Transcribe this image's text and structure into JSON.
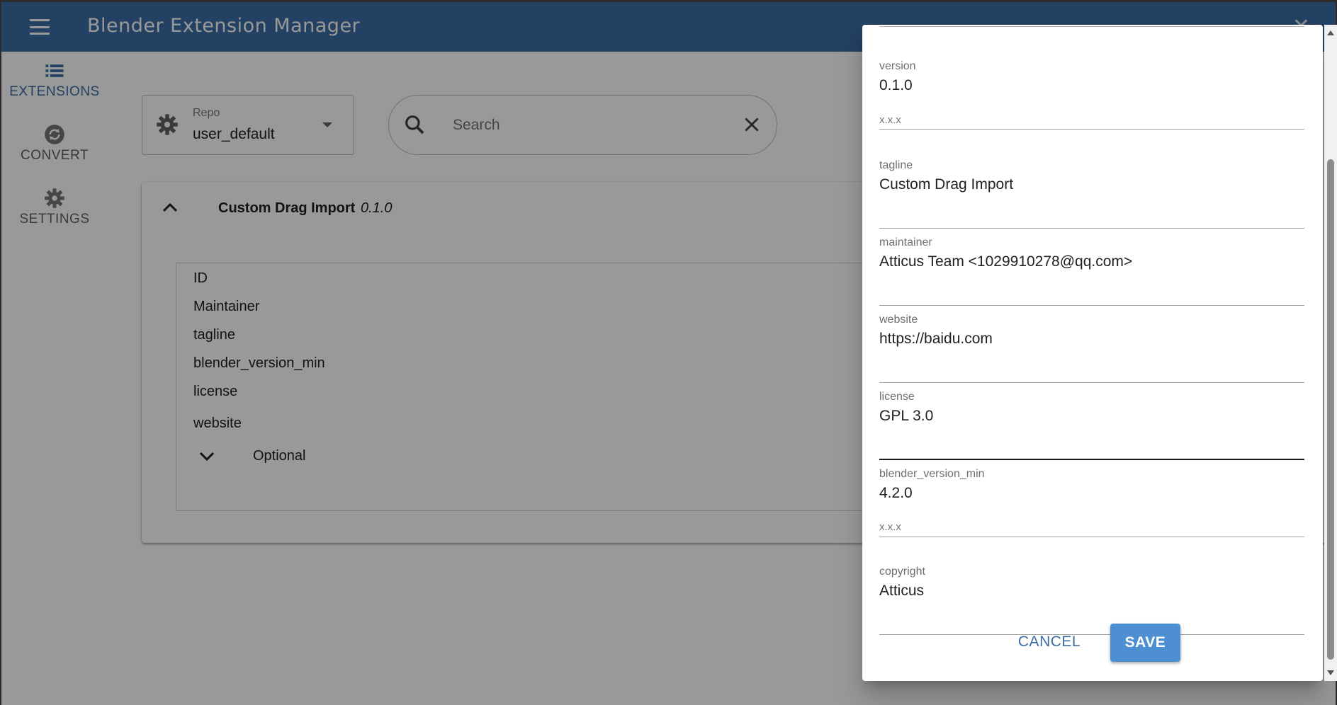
{
  "app": {
    "title": "Blender Extension Manager"
  },
  "colors": {
    "primary": "#3b6da3",
    "save_button": "#4e8fd2",
    "scrim": "rgba(0,0,0,0.40)"
  },
  "nav": {
    "items": [
      {
        "label": "EXTENSIONS",
        "icon": "list-icon",
        "active": true
      },
      {
        "label": "CONVERT",
        "icon": "sync-icon",
        "active": false
      },
      {
        "label": "SETTINGS",
        "icon": "gear-icon",
        "active": false
      }
    ]
  },
  "repo": {
    "label": "Repo",
    "value": "user_default"
  },
  "search": {
    "placeholder": "Search",
    "value": ""
  },
  "extension": {
    "name": "Custom Drag Import",
    "version": "0.1.0",
    "fields": [
      "ID",
      "Maintainer",
      "tagline",
      "blender_version_min",
      "license",
      "website"
    ],
    "optional_label": "Optional"
  },
  "dialog": {
    "fields": [
      {
        "label": "version",
        "value": "0.1.0",
        "hint": "x.x.x"
      },
      {
        "label": "tagline",
        "value": "Custom Drag Import"
      },
      {
        "label": "maintainer",
        "value": "Atticus Team <1029910278@qq.com>"
      },
      {
        "label": "website",
        "value": "https://baidu.com"
      },
      {
        "label": "license",
        "value": "GPL 3.0",
        "focused": true
      },
      {
        "label": "blender_version_min",
        "value": "4.2.0",
        "hint": "x.x.x"
      },
      {
        "label": "copyright",
        "value": "Atticus"
      }
    ],
    "cancel_label": "CANCEL",
    "save_label": "SAVE"
  }
}
